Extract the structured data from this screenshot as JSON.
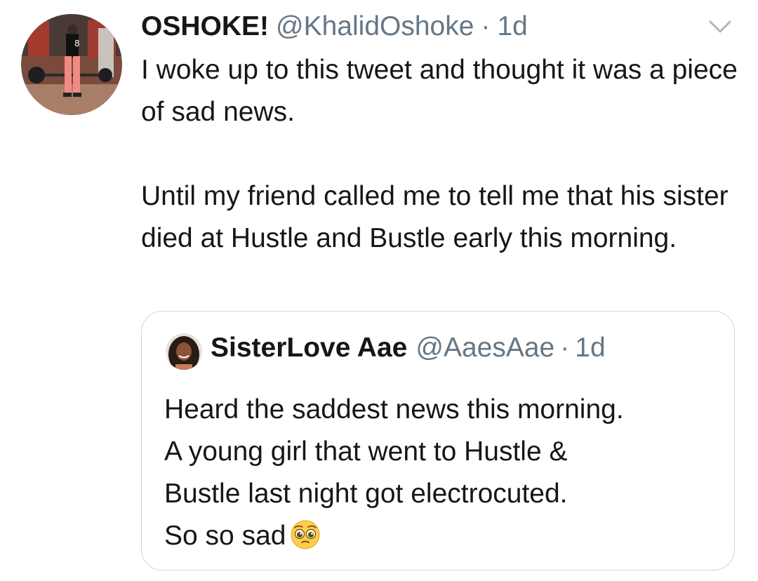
{
  "tweet": {
    "author_name": "OSHOKE!",
    "author_handle": "@KhalidOshoke",
    "separator": "·",
    "time": "1d",
    "avatar_icon": "profile-photo-man-in-gym",
    "menu_icon": "chevron-down-icon",
    "paragraph1": "I woke up to this tweet and thought it was a piece of sad news.",
    "paragraph2": "Until my friend called me to tell me that his sister died at Hustle and Bustle early this morning."
  },
  "quoted_tweet": {
    "author_name": "SisterLove Aae",
    "author_handle": "@AaesAae",
    "separator": "·",
    "time": "1d",
    "avatar_icon": "profile-photo-woman",
    "lines": [
      "Heard the saddest news this morning.",
      "A young girl that went to Hustle &",
      "Bustle last night got electrocuted.",
      "So so sad"
    ],
    "emoji": "pleading-face-emoji"
  },
  "colors": {
    "text_primary": "#14171a",
    "text_secondary": "#657786",
    "border": "#ccd6dd",
    "background": "#ffffff"
  }
}
